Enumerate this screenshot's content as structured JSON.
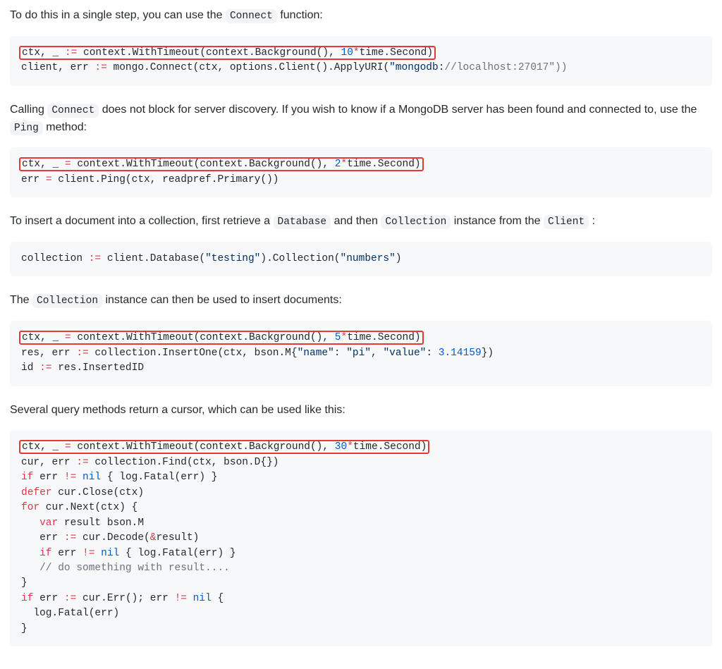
{
  "p1": {
    "pre": "To do this in a single step, you can use the ",
    "code": "Connect",
    "post": " function:"
  },
  "cb1": {
    "l1a": "ctx, _ ",
    "l1b": ":=",
    "l1c": " context.WithTimeout(context.Background(), ",
    "l1d": "10",
    "l1e": "*",
    "l1f": "time.Second)",
    "l2a": "client, err ",
    "l2b": ":=",
    "l2c": " mongo.Connect(ctx, options.Client().ApplyURI(",
    "l2d": "\"mongodb:",
    "l2e": "//localhost:27017\"))"
  },
  "p2": {
    "pre": "Calling ",
    "code1": "Connect",
    "mid": " does not block for server discovery. If you wish to know if a MongoDB server has been found and connected to, use the ",
    "code2": "Ping",
    "post": " method:"
  },
  "cb2": {
    "l1a": "ctx, _ ",
    "l1b": "=",
    "l1c": " context.WithTimeout(context.Background(), ",
    "l1d": "2",
    "l1e": "*",
    "l1f": "time.Second)",
    "l2a": "err ",
    "l2b": "=",
    "l2c": " client.Ping(ctx, readpref.Primary())"
  },
  "p3": {
    "pre": "To insert a document into a collection, first retrieve a ",
    "code1": "Database",
    "mid1": " and then ",
    "code2": "Collection",
    "mid2": " instance from the ",
    "code3": "Client",
    "post": " :"
  },
  "cb3": {
    "l1a": "collection ",
    "l1b": ":=",
    "l1c": " client.Database(",
    "l1d": "\"testing\"",
    "l1e": ").Collection(",
    "l1f": "\"numbers\"",
    "l1g": ")"
  },
  "p4": {
    "pre": "The ",
    "code": "Collection",
    "post": " instance can then be used to insert documents:"
  },
  "cb4": {
    "l1a": "ctx, _ ",
    "l1b": "=",
    "l1c": " context.WithTimeout(context.Background(), ",
    "l1d": "5",
    "l1e": "*",
    "l1f": "time.Second)",
    "l2a": "res, err ",
    "l2b": ":=",
    "l2c": " collection.InsertOne(ctx, bson.M{",
    "l2d": "\"name\"",
    "l2e": ": ",
    "l2f": "\"pi\"",
    "l2g": ", ",
    "l2h": "\"value\"",
    "l2i": ": ",
    "l2j": "3.14159",
    "l2k": "})",
    "l3a": "id ",
    "l3b": ":=",
    "l3c": " res.InsertedID"
  },
  "p5": {
    "text": "Several query methods return a cursor, which can be used like this:"
  },
  "cb5": {
    "l1a": "ctx, _ ",
    "l1b": "=",
    "l1c": " context.WithTimeout(context.Background(), ",
    "l1d": "30",
    "l1e": "*",
    "l1f": "time.Second)",
    "l2a": "cur, err ",
    "l2b": ":=",
    "l2c": " collection.Find(ctx, bson.D{})",
    "l3a": "if",
    "l3b": " err ",
    "l3c": "!=",
    "l3d": " ",
    "l3e": "nil",
    "l3f": " { log.Fatal(err) }",
    "l4a": "defer",
    "l4b": " cur.Close(ctx)",
    "l5a": "for",
    "l5b": " cur.Next(ctx) {",
    "l6a": "   ",
    "l6b": "var",
    "l6c": " result bson.M",
    "l7a": "   err ",
    "l7b": ":=",
    "l7c": " cur.Decode(",
    "l7d": "&",
    "l7e": "result)",
    "l8a": "   ",
    "l8b": "if",
    "l8c": " err ",
    "l8d": "!=",
    "l8e": " ",
    "l8f": "nil",
    "l8g": " { log.Fatal(err) }",
    "l9a": "   ",
    "l9b": "// do something with result....",
    "l10": "}",
    "l11a": "if",
    "l11b": " err ",
    "l11c": ":=",
    "l11d": " cur.Err(); err ",
    "l11e": "!=",
    "l11f": " ",
    "l11g": "nil",
    "l11h": " {",
    "l12": "  log.Fatal(err)",
    "l13": "}"
  }
}
